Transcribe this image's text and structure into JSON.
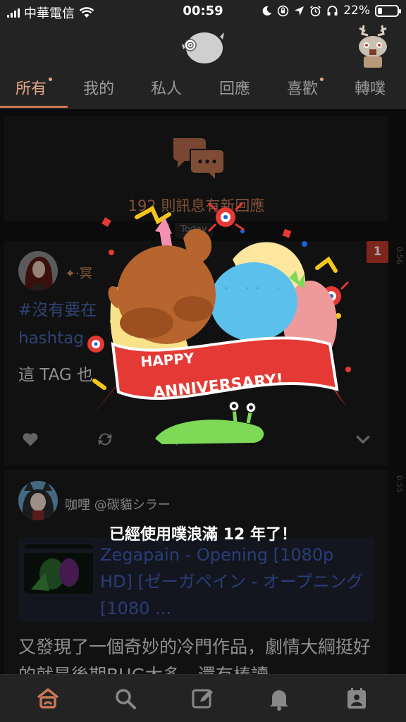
{
  "status_bar": {
    "carrier": "中華電信",
    "time": "00:59",
    "battery_percent": "22%",
    "battery_level": 0.22
  },
  "tabs": [
    {
      "label": "所有",
      "active": true,
      "has_dot": true
    },
    {
      "label": "我的",
      "active": false,
      "has_dot": false
    },
    {
      "label": "私人",
      "active": false,
      "has_dot": false
    },
    {
      "label": "回應",
      "active": false,
      "has_dot": false
    },
    {
      "label": "喜歡",
      "active": false,
      "has_dot": true
    },
    {
      "label": "轉噗",
      "active": false,
      "has_dot": false
    }
  ],
  "replies_card": {
    "text": "192 則訊息有新回應"
  },
  "today_chip": "Today",
  "posts": [
    {
      "author": "✦·冥",
      "time": "0:56",
      "badge": "1",
      "tag_line1": "#沒有要在",
      "tag_line2": "hashtag",
      "text": "這 TAG 也"
    },
    {
      "author": "咖哩 @碳貓シラー",
      "time": "0:55",
      "link_title": "Zegapain - Opening [1080p HD] [ゼーガペイン - オープニング[1080 ...",
      "text": "又發現了一個奇妙的冷門作品，劇情大綱挺好的就是後期BUG太多，還有棒讀"
    }
  ],
  "anniversary": {
    "banner": "HAPPY ANNIVERSARY!",
    "message": "已經使用噗浪滿 12 年了！"
  },
  "colors": {
    "accent": "#c87856",
    "link": "#3f5fb8",
    "badge": "#c0392b"
  },
  "bottom_nav": [
    "home-icon",
    "search-icon",
    "compose-icon",
    "bell-icon",
    "profile-card-icon"
  ]
}
